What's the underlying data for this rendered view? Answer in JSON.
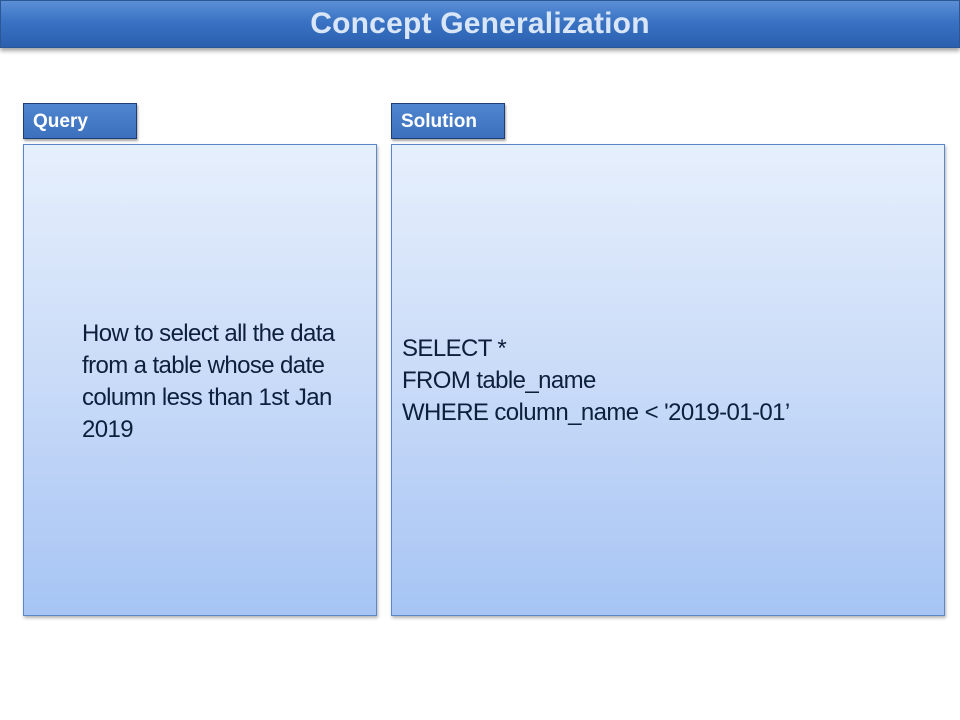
{
  "title": "Concept Generalization",
  "query": {
    "label": "Query",
    "text": "How to select all the data from a table whose date column less than 1st Jan 2019"
  },
  "solution": {
    "label": "Solution",
    "lines": [
      "SELECT *",
      "FROM table_name",
      "WHERE column_name < '2019-01-01’"
    ]
  },
  "colors": {
    "title_bar": "#3a73c4",
    "tab": "#4377c4",
    "panel_top": "#e6effc",
    "panel_bottom": "#a6c4f4",
    "text": "#0c1f3b"
  }
}
